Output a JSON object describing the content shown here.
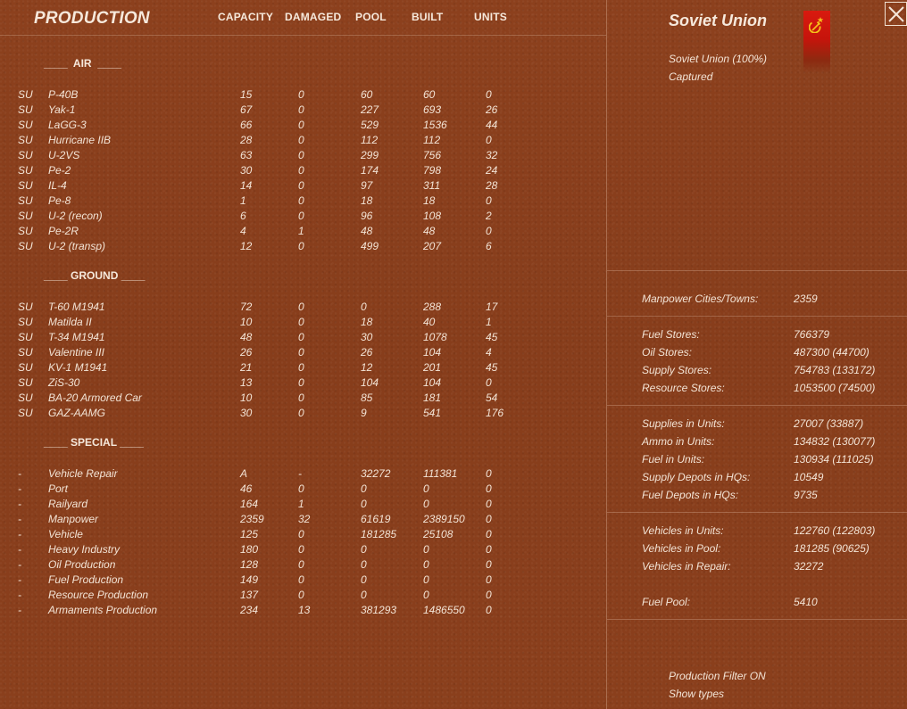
{
  "header": {
    "title": "PRODUCTION",
    "columns": [
      "CAPACITY",
      "DAMAGED",
      "POOL",
      "BUILT",
      "UNITS"
    ]
  },
  "sections": {
    "air": "____  AIR  ____",
    "ground": "____ GROUND ____",
    "special": "____ SPECIAL ____"
  },
  "air_rows": [
    {
      "nat": "SU",
      "name": "P-40B",
      "capacity": "15",
      "damaged": "0",
      "pool": "60",
      "built": "60",
      "units": "0"
    },
    {
      "nat": "SU",
      "name": "Yak-1",
      "capacity": "67",
      "damaged": "0",
      "pool": "227",
      "built": "693",
      "units": "26"
    },
    {
      "nat": "SU",
      "name": "LaGG-3",
      "capacity": "66",
      "damaged": "0",
      "pool": "529",
      "built": "1536",
      "units": "44"
    },
    {
      "nat": "SU",
      "name": "Hurricane IIB",
      "capacity": "28",
      "damaged": "0",
      "pool": "112",
      "built": "112",
      "units": "0"
    },
    {
      "nat": "SU",
      "name": "U-2VS",
      "capacity": "63",
      "damaged": "0",
      "pool": "299",
      "built": "756",
      "units": "32"
    },
    {
      "nat": "SU",
      "name": "Pe-2",
      "capacity": "30",
      "damaged": "0",
      "pool": "174",
      "built": "798",
      "units": "24"
    },
    {
      "nat": "SU",
      "name": "IL-4",
      "capacity": "14",
      "damaged": "0",
      "pool": "97",
      "built": "311",
      "units": "28"
    },
    {
      "nat": "SU",
      "name": "Pe-8",
      "capacity": "1",
      "damaged": "0",
      "pool": "18",
      "built": "18",
      "units": "0"
    },
    {
      "nat": "SU",
      "name": "U-2 (recon)",
      "capacity": "6",
      "damaged": "0",
      "pool": "96",
      "built": "108",
      "units": "2"
    },
    {
      "nat": "SU",
      "name": "Pe-2R",
      "capacity": "4",
      "damaged": "1",
      "pool": "48",
      "built": "48",
      "units": "0"
    },
    {
      "nat": "SU",
      "name": "U-2 (transp)",
      "capacity": "12",
      "damaged": "0",
      "pool": "499",
      "built": "207",
      "units": "6"
    }
  ],
  "ground_rows": [
    {
      "nat": "SU",
      "name": "T-60 M1941",
      "capacity": "72",
      "damaged": "0",
      "pool": "0",
      "built": "288",
      "units": "17"
    },
    {
      "nat": "SU",
      "name": "Matilda II",
      "capacity": "10",
      "damaged": "0",
      "pool": "18",
      "built": "40",
      "units": "1"
    },
    {
      "nat": "SU",
      "name": "T-34 M1941",
      "capacity": "48",
      "damaged": "0",
      "pool": "30",
      "built": "1078",
      "units": "45"
    },
    {
      "nat": "SU",
      "name": "Valentine III",
      "capacity": "26",
      "damaged": "0",
      "pool": "26",
      "built": "104",
      "units": "4"
    },
    {
      "nat": "SU",
      "name": "KV-1 M1941",
      "capacity": "21",
      "damaged": "0",
      "pool": "12",
      "built": "201",
      "units": "45"
    },
    {
      "nat": "SU",
      "name": "ZiS-30",
      "capacity": "13",
      "damaged": "0",
      "pool": "104",
      "built": "104",
      "units": "0"
    },
    {
      "nat": "SU",
      "name": "BA-20 Armored Car",
      "capacity": "10",
      "damaged": "0",
      "pool": "85",
      "built": "181",
      "units": "54"
    },
    {
      "nat": "SU",
      "name": "GAZ-AAMG",
      "capacity": "30",
      "damaged": "0",
      "pool": "9",
      "built": "541",
      "units": "176"
    }
  ],
  "special_rows": [
    {
      "nat": "-",
      "name": "Vehicle Repair",
      "capacity": "A",
      "damaged": "-",
      "pool": "32272",
      "built": "111381",
      "units": "0"
    },
    {
      "nat": "-",
      "name": "Port",
      "capacity": "46",
      "damaged": "0",
      "pool": "0",
      "built": "0",
      "units": "0"
    },
    {
      "nat": "-",
      "name": "Railyard",
      "capacity": "164",
      "damaged": "1",
      "pool": "0",
      "built": "0",
      "units": "0"
    },
    {
      "nat": "-",
      "name": "Manpower",
      "capacity": "2359",
      "damaged": "32",
      "pool": "61619",
      "built": "2389150",
      "units": "0"
    },
    {
      "nat": "-",
      "name": "Vehicle",
      "capacity": "125",
      "damaged": "0",
      "pool": "181285",
      "built": "25108",
      "units": "0"
    },
    {
      "nat": "-",
      "name": "Heavy Industry",
      "capacity": "180",
      "damaged": "0",
      "pool": "0",
      "built": "0",
      "units": "0"
    },
    {
      "nat": "-",
      "name": "Oil Production",
      "capacity": "128",
      "damaged": "0",
      "pool": "0",
      "built": "0",
      "units": "0"
    },
    {
      "nat": "-",
      "name": "Fuel Production",
      "capacity": "149",
      "damaged": "0",
      "pool": "0",
      "built": "0",
      "units": "0"
    },
    {
      "nat": "-",
      "name": "Resource Production",
      "capacity": "137",
      "damaged": "0",
      "pool": "0",
      "built": "0",
      "units": "0"
    },
    {
      "nat": "-",
      "name": "Armaments Production",
      "capacity": "234",
      "damaged": "13",
      "pool": "381293",
      "built": "1486550",
      "units": "0"
    }
  ],
  "side": {
    "country": "Soviet Union",
    "ownership": "Soviet Union  (100%)",
    "status": "Captured",
    "flag_icon": "hammer-and-sickle-icon",
    "flag_color": "#d91a0f",
    "stats": [
      [
        {
          "label": "Manpower Cities/Towns:",
          "value": "2359"
        }
      ],
      [
        {
          "label": "Fuel Stores:",
          "value": "766379"
        },
        {
          "label": "Oil Stores:",
          "value": "487300 (44700)"
        },
        {
          "label": "Supply Stores:",
          "value": "754783 (133172)"
        },
        {
          "label": "Resource Stores:",
          "value": "1053500 (74500)"
        }
      ],
      [
        {
          "label": "Supplies in Units:",
          "value": "27007 (33887)"
        },
        {
          "label": "Ammo in Units:",
          "value": "134832 (130077)"
        },
        {
          "label": "Fuel in Units:",
          "value": "130934 (111025)"
        },
        {
          "label": "Supply Depots in HQs:",
          "value": "10549"
        },
        {
          "label": "Fuel Depots in HQs:",
          "value": "9735"
        }
      ],
      [
        {
          "label": "Vehicles in Units:",
          "value": "122760 (122803)"
        },
        {
          "label": "Vehicles in Pool:",
          "value": "181285 (90625)"
        },
        {
          "label": "Vehicles in Repair:",
          "value": "32272"
        },
        {
          "label": "Fuel Pool:",
          "value": "5410"
        }
      ]
    ],
    "options": {
      "filter": "Production Filter ON",
      "show_types": "Show types"
    }
  }
}
